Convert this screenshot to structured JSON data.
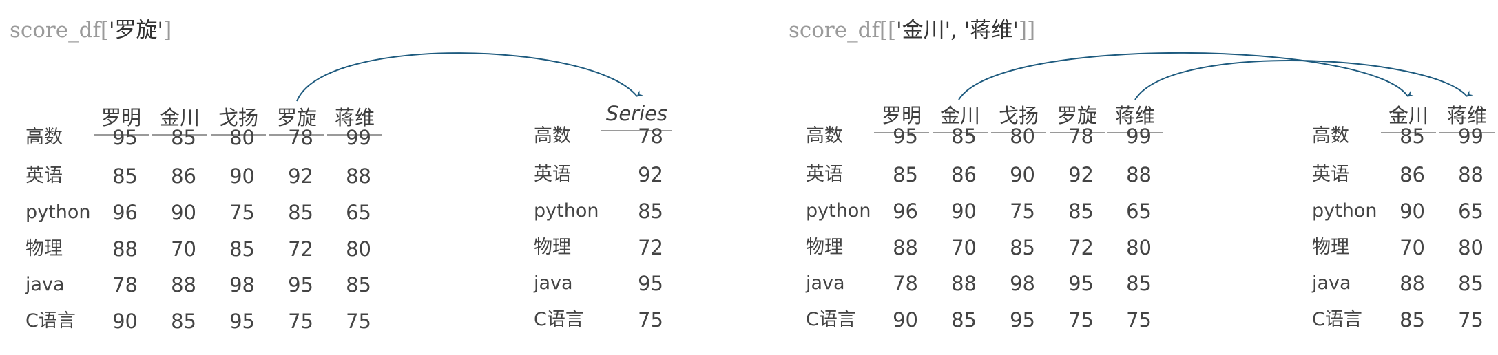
{
  "left_code": {
    "prefix": "score_df[",
    "arg": "'罗旋'",
    "suffix": "]"
  },
  "right_code": {
    "prefix": "score_df[[",
    "arg": "'金川', '蒋维'",
    "suffix": "]]"
  },
  "columns": [
    "罗明",
    "金川",
    "戈扬",
    "罗旋",
    "蒋维"
  ],
  "rows": [
    "高数",
    "英语",
    "python",
    "物理",
    "java",
    "C语言"
  ],
  "values": [
    [
      95,
      85,
      80,
      78,
      99
    ],
    [
      85,
      86,
      90,
      92,
      88
    ],
    [
      96,
      90,
      75,
      85,
      65
    ],
    [
      88,
      70,
      85,
      72,
      80
    ],
    [
      78,
      88,
      98,
      95,
      85
    ],
    [
      90,
      85,
      95,
      75,
      75
    ]
  ],
  "series_result": {
    "header": "Series",
    "values": [
      78,
      92,
      85,
      72,
      95,
      75
    ]
  },
  "df_result": {
    "columns": [
      "金川",
      "蒋维"
    ],
    "values": [
      [
        85,
        99
      ],
      [
        86,
        88
      ],
      [
        90,
        65
      ],
      [
        70,
        80
      ],
      [
        88,
        85
      ],
      [
        85,
        75
      ]
    ]
  },
  "arrow_color": "#1d5a7e"
}
